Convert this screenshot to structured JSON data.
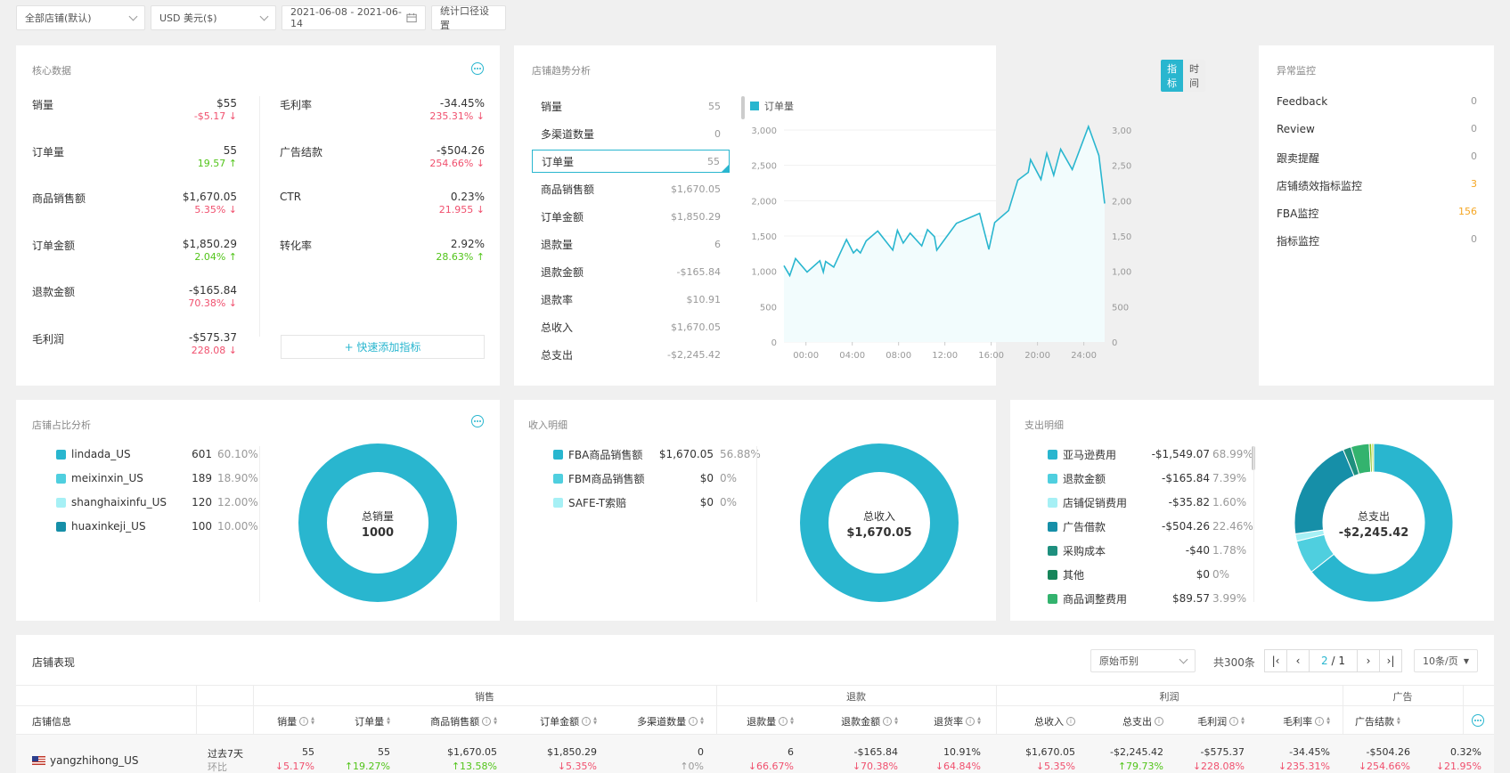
{
  "toolbar": {
    "store_select": "全部店铺(默认)",
    "currency_select": "USD 美元($)",
    "date_range": "2021-06-08 - 2021-06-14",
    "stat_settings": "统计口径设置"
  },
  "core": {
    "title": "核心数据",
    "add_metric": "+ 快速添加指标",
    "left": [
      {
        "label": "销量",
        "value": "$55",
        "change": "-$5.17 ↓",
        "dir": "down"
      },
      {
        "label": "订单量",
        "value": "55",
        "change": "19.57 ↑",
        "dir": "up"
      },
      {
        "label": "商品销售额",
        "value": "$1,670.05",
        "change": "5.35% ↓",
        "dir": "down"
      },
      {
        "label": "订单金额",
        "value": "$1,850.29",
        "change": "2.04% ↑",
        "dir": "up"
      },
      {
        "label": "退款金额",
        "value": "-$165.84",
        "change": "70.38% ↓",
        "dir": "down"
      },
      {
        "label": "毛利润",
        "value": "-$575.37",
        "change": "228.08 ↓",
        "dir": "down"
      }
    ],
    "right": [
      {
        "label": "毛利率",
        "value": "-34.45%",
        "change": "235.31% ↓",
        "dir": "down"
      },
      {
        "label": "广告结款",
        "value": "-$504.26",
        "change": "254.66% ↓",
        "dir": "down"
      },
      {
        "label": "CTR",
        "value": "0.23%",
        "change": "21.955 ↓",
        "dir": "down"
      },
      {
        "label": "转化率",
        "value": "2.92%",
        "change": "28.63% ↑",
        "dir": "up"
      }
    ]
  },
  "trend": {
    "title": "店铺趋势分析",
    "toggle": [
      "指标",
      "时间"
    ],
    "items": [
      {
        "label": "销量",
        "value": "55"
      },
      {
        "label": "多渠道数量",
        "value": "0"
      },
      {
        "label": "订单量",
        "value": "55",
        "active": true
      },
      {
        "label": "商品销售额",
        "value": "$1,670.05"
      },
      {
        "label": "订单金额",
        "value": "$1,850.29"
      },
      {
        "label": "退款量",
        "value": "6"
      },
      {
        "label": "退款金额",
        "value": "-$165.84"
      },
      {
        "label": "退款率",
        "value": "$10.91"
      },
      {
        "label": "总收入",
        "value": "$1,670.05"
      },
      {
        "label": "总支出",
        "value": "-$2,245.42"
      }
    ]
  },
  "chart_data": [
    {
      "type": "area",
      "title": "",
      "legend": [
        "订单量"
      ],
      "legend_position": "top-left",
      "xlabel": "",
      "ylabel": "",
      "ylim": [
        0,
        3000
      ],
      "yticks": [
        "0",
        "500",
        "1,000",
        "1,500",
        "2,000",
        "2,500",
        "3,000"
      ],
      "yticks_right": [
        "0",
        "500",
        "1,000",
        "1,500",
        "2,000",
        "2,500",
        "3,000"
      ],
      "xticks": [
        "00:00",
        "04:00",
        "08:00",
        "12:00",
        "16:00",
        "20:00",
        "24:00"
      ],
      "xlim": [
        -1.9,
        25.8
      ],
      "grid": true,
      "series": [
        {
          "name": "订单量",
          "x": [
            -1.9,
            -1.4,
            -0.9,
            0.1,
            1.2,
            1.5,
            1.7,
            2.4,
            3.5,
            4.1,
            4.4,
            4.7,
            5.2,
            6.2,
            7.5,
            7.9,
            8.4,
            9.0,
            10.0,
            10.5,
            11.1,
            11.3,
            13.0,
            15.0,
            15.8,
            16.3,
            17.5,
            18.3,
            19.2,
            19.4,
            20.3,
            20.8,
            21.4,
            22.0,
            23.0,
            24.4,
            25.3,
            25.8
          ],
          "y": [
            1080,
            940,
            1180,
            990,
            1150,
            990,
            1140,
            1060,
            1450,
            1260,
            1310,
            1260,
            1430,
            1570,
            1300,
            1580,
            1400,
            1540,
            1360,
            1590,
            1490,
            1300,
            1680,
            1820,
            1310,
            1690,
            1860,
            2290,
            2400,
            2580,
            2300,
            2670,
            2360,
            2730,
            2440,
            3050,
            2640,
            1960
          ]
        }
      ]
    },
    {
      "type": "pie",
      "title": "店铺占比分析",
      "center_label": "总销量",
      "center_value": "1000",
      "categories": [
        "lindada_US",
        "meixinxin_US",
        "shanghaixinfu_US",
        "huaxinkeji_US"
      ],
      "values": [
        601,
        189,
        120,
        100
      ],
      "percents": [
        "60.10%",
        "18.90%",
        "12.00%",
        "10.00%"
      ],
      "colors": [
        "#29b6cf",
        "#4fcfdf",
        "#a6f0f5",
        "#168fa8"
      ]
    },
    {
      "type": "pie",
      "title": "收入明细",
      "center_label": "总收入",
      "center_value": "$1,670.05",
      "categories": [
        "FBA商品销售额",
        "FBM商品销售额",
        "SAFE-T索赔"
      ],
      "values": [
        1670.05,
        0,
        0
      ],
      "display_values": [
        "$1,670.05",
        "$0",
        "$0"
      ],
      "percents": [
        "56.88%",
        "0%",
        "0%"
      ],
      "colors": [
        "#29b6cf",
        "#4fcfdf",
        "#a6f0f5"
      ]
    },
    {
      "type": "pie",
      "title": "支出明细",
      "center_label": "总支出",
      "center_value": "-$2,245.42",
      "categories": [
        "亚马逊费用",
        "退款金额",
        "店铺促销费用",
        "广告借款",
        "采购成本",
        "其他",
        "商品调整费用"
      ],
      "values": [
        1549.07,
        165.84,
        35.82,
        504.26,
        40,
        0,
        89.57
      ],
      "display_values": [
        "-$1,549.07",
        "-$165.84",
        "-$35.82",
        "-$504.26",
        "-$40",
        "$0",
        "$89.57"
      ],
      "percents": [
        "68.99%",
        "7.39%",
        "1.60%",
        "22.46%",
        "1.78%",
        "0%",
        "3.99%"
      ],
      "colors": [
        "#29b6cf",
        "#4fcfdf",
        "#a6f0f5",
        "#168fa8",
        "#1e8f7e",
        "#17855a",
        "#33b36e"
      ],
      "extra_slices": [
        {
          "value": 12,
          "color": "#7fbf1e"
        },
        {
          "value": 10,
          "color": "#c4e05a"
        }
      ]
    }
  ],
  "monitor": {
    "title": "异常监控",
    "items": [
      {
        "label": "Feedback",
        "value": "0"
      },
      {
        "label": "Review",
        "value": "0"
      },
      {
        "label": "跟卖提醒",
        "value": "0"
      },
      {
        "label": "店铺绩效指标监控",
        "value": "3",
        "highlight": true
      },
      {
        "label": "FBA监控",
        "value": "156",
        "highlight": true
      },
      {
        "label": "指标监控",
        "value": "0"
      }
    ]
  },
  "performance": {
    "title": "店铺表现",
    "currency_select": "原始币别",
    "total": "共300条",
    "page_current": "2",
    "page_total": "/ 1",
    "page_size": "10条/页",
    "groups": [
      "销售",
      "退款",
      "利润",
      "广告"
    ],
    "columns": [
      {
        "label": "店铺信息"
      },
      {
        "label": "销量",
        "info": true,
        "sort": true
      },
      {
        "label": "订单量",
        "sort": true
      },
      {
        "label": "商品销售额",
        "info": true,
        "sort": true
      },
      {
        "label": "订单金额",
        "info": true,
        "sort": true
      },
      {
        "label": "多渠道数量",
        "info": true,
        "sort": true
      },
      {
        "label": "退款量",
        "info": true,
        "sort": true
      },
      {
        "label": "退款金额",
        "info": true,
        "sort": true
      },
      {
        "label": "退货率",
        "info": true,
        "sort": true
      },
      {
        "label": "总收入",
        "info": true
      },
      {
        "label": "总支出",
        "info": true
      },
      {
        "label": "毛利润",
        "info": true,
        "sort": true
      },
      {
        "label": "毛利率",
        "info": true,
        "sort": true
      },
      {
        "label": "广告结款",
        "sort": true
      }
    ],
    "rows": [
      {
        "store": "yangzhihong_US",
        "period": "过去7天",
        "period2": "环比",
        "values": [
          "55",
          "55",
          "$1,670.05",
          "$1,850.29",
          "0",
          "6",
          "-$165.84",
          "10.91%",
          "$1,670.05",
          "-$2,245.42",
          "-$575.37",
          "-34.45%",
          "-$504.26",
          "0.32%"
        ],
        "changes": [
          "↓5.17%",
          "↑19.27%",
          "↑13.58%",
          "↓5.35%",
          "↑0%",
          "↓66.67%",
          "↓70.38%",
          "↓64.84%",
          "↓5.35%",
          "↑79.73%",
          "↓228.08%",
          "↓235.31%",
          "↓254.66%",
          "↓21.95%"
        ],
        "change_dirs": [
          "down",
          "up",
          "up",
          "down",
          "neutral",
          "down",
          "down",
          "down",
          "down",
          "up",
          "down",
          "down",
          "down",
          "down"
        ]
      }
    ]
  },
  "colors": {
    "accent": "#29b6cf",
    "down": "#f0506e",
    "up": "#52c41a",
    "warning": "#f5a623"
  }
}
